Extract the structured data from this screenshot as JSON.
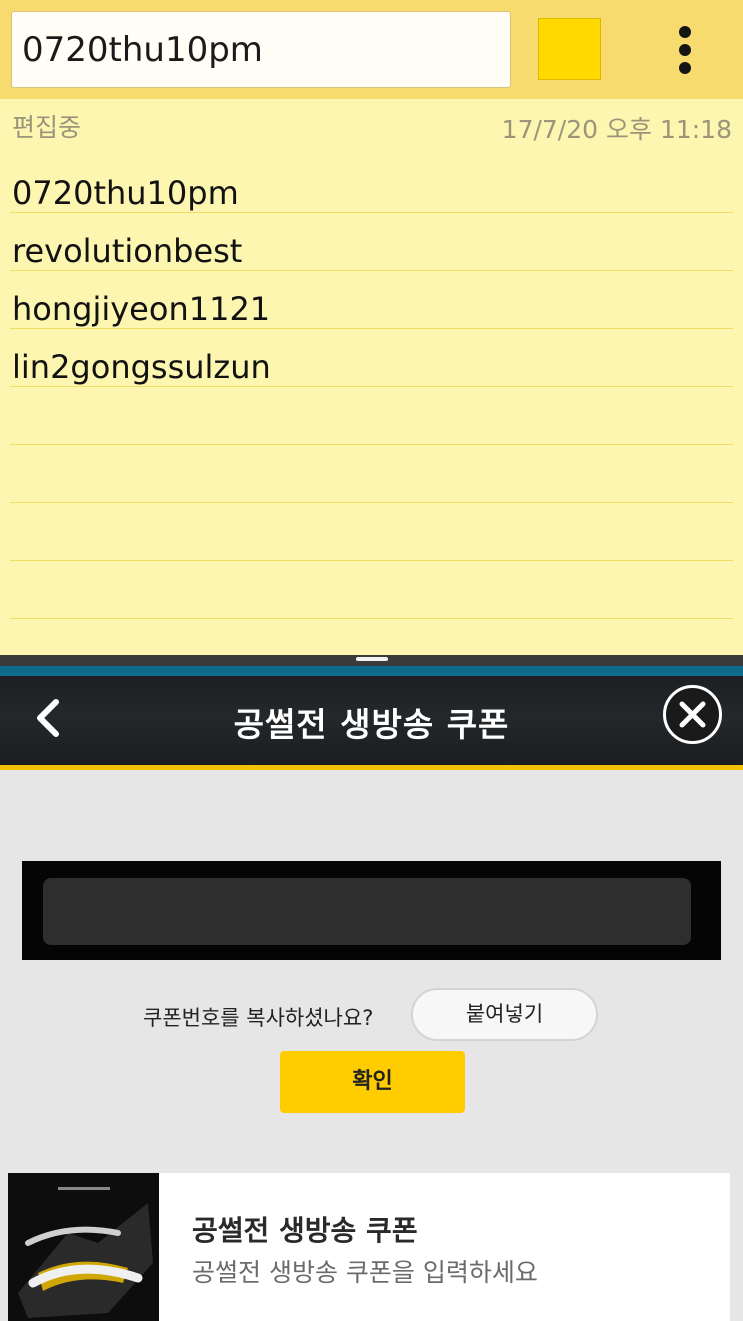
{
  "memo": {
    "title_value": "0720thu10pm",
    "color": "#ffd900",
    "status": "편집중",
    "timestamp": "17/7/20 오후 11:18",
    "lines": [
      "0720thu10pm",
      "revolutionbest",
      "hongjiyeon1121",
      "lin2gongssulzun",
      "",
      "",
      "",
      ""
    ],
    "more_icon": "more-vertical-icon"
  },
  "coupon_page": {
    "header": {
      "title": "공썰전 생방송 쿠폰",
      "back_icon": "chevron-left-icon",
      "close_icon": "close-icon"
    },
    "code_input": {
      "value": "",
      "placeholder": ""
    },
    "paste_prompt": "쿠폰번호를 복사하셨나요?",
    "paste_label": "붙여넣기",
    "confirm_label": "확인",
    "card": {
      "title": "공썰전 생방송 쿠폰",
      "subtitle": "공썰전 생방송 쿠폰을 입력하세요"
    }
  },
  "colors": {
    "toolbar": "#f7db6e",
    "paper": "#fcf6b0",
    "accent": "#ffcc00"
  }
}
